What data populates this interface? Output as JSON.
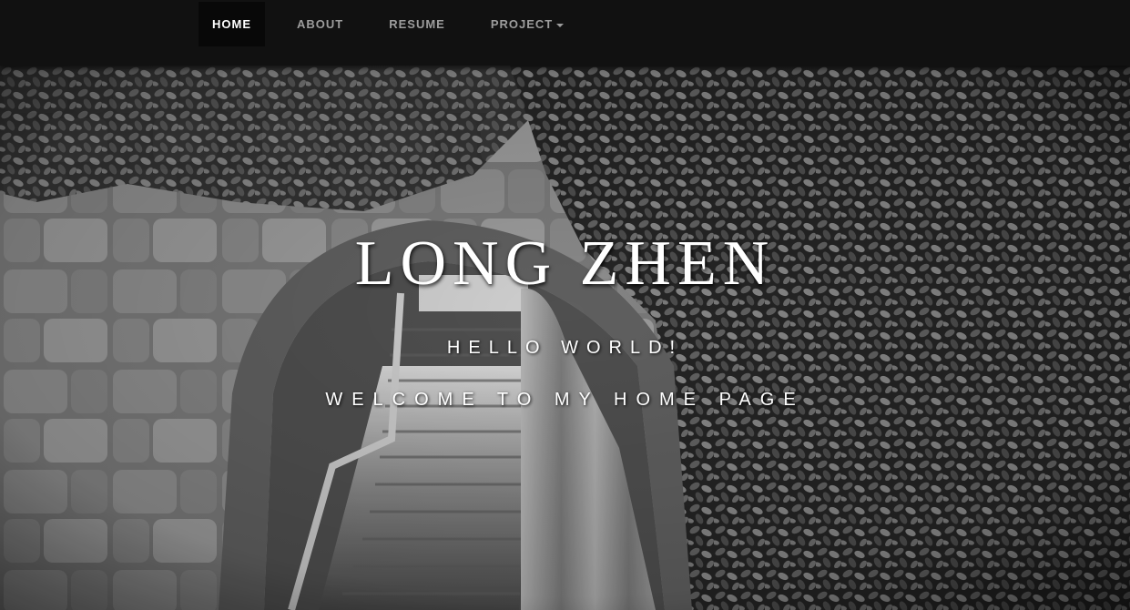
{
  "nav": {
    "items": [
      {
        "label": "HOME",
        "active": true
      },
      {
        "label": "ABOUT"
      },
      {
        "label": "RESUME"
      },
      {
        "label": "PROJECT",
        "dropdown": true
      }
    ]
  },
  "hero": {
    "title": "LONG ZHEN",
    "subtitle_1": "HELLO WORLD!",
    "subtitle_2": "WELCOME TO MY HOME PAGE",
    "background": "black-and-white photo of a stone archway with ivy-covered wall, stairs and curtain"
  },
  "colors": {
    "navbar_bg": "#111111",
    "nav_active_bg": "#080808",
    "nav_text": "#9d9d9d",
    "nav_active_text": "#ffffff",
    "hero_text": "#ffffff"
  }
}
